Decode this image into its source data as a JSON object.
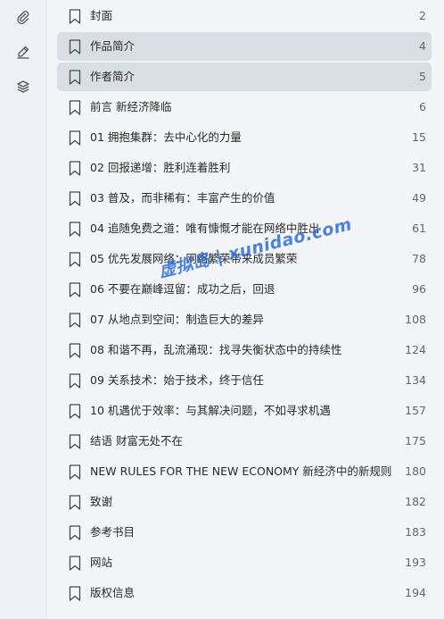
{
  "sidebar": {
    "icons": [
      "paperclip-icon",
      "pen-icon",
      "layers-icon"
    ]
  },
  "toc": [
    {
      "title": "封面",
      "page": "2",
      "selected": false
    },
    {
      "title": "作品简介",
      "page": "4",
      "selected": true
    },
    {
      "title": "作者简介",
      "page": "5",
      "selected": true
    },
    {
      "title": "前言 新经济降临",
      "page": "6",
      "selected": false
    },
    {
      "title": "01 拥抱集群：去中心化的力量",
      "page": "15",
      "selected": false
    },
    {
      "title": "02 回报递增：胜利连着胜利",
      "page": "31",
      "selected": false
    },
    {
      "title": "03 普及，而非稀有：丰富产生的价值",
      "page": "49",
      "selected": false
    },
    {
      "title": "04 追随免费之道：唯有慷慨才能在网络中胜出",
      "page": "61",
      "selected": false
    },
    {
      "title": "05 优先发展网络：网络繁荣带来成员繁荣",
      "page": "78",
      "selected": false
    },
    {
      "title": "06 不要在巅峰逗留：成功之后，回退",
      "page": "96",
      "selected": false
    },
    {
      "title": "07 从地点到空间：制造巨大的差异",
      "page": "108",
      "selected": false
    },
    {
      "title": "08 和谐不再，乱流涌现：找寻失衡状态中的持续性",
      "page": "124",
      "selected": false
    },
    {
      "title": "09 关系技术：始于技术，终于信任",
      "page": "134",
      "selected": false
    },
    {
      "title": "10 机遇优于效率：与其解决问题，不如寻求机遇",
      "page": "157",
      "selected": false
    },
    {
      "title": "结语 财富无处不在",
      "page": "175",
      "selected": false
    },
    {
      "title": "NEW RULES FOR THE NEW ECONOMY 新经济中的新规则",
      "page": "180",
      "selected": false
    },
    {
      "title": "致谢",
      "page": "182",
      "selected": false
    },
    {
      "title": "参考书目",
      "page": "183",
      "selected": false
    },
    {
      "title": "网站",
      "page": "193",
      "selected": false
    },
    {
      "title": "版权信息",
      "page": "194",
      "selected": false
    }
  ],
  "watermark": {
    "text": "虚拟岛 | xunidao.com",
    "color": "#2f6fd6"
  }
}
